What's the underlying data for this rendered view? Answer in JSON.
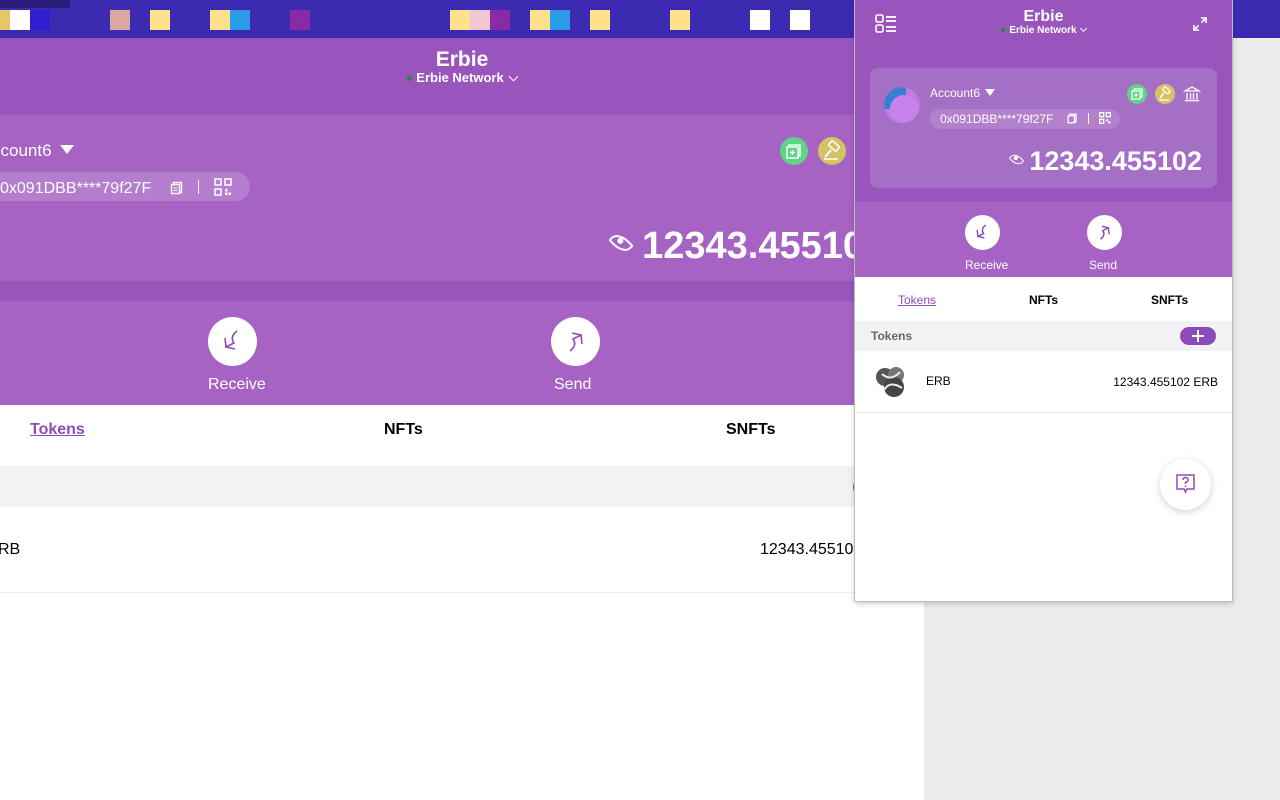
{
  "background": {
    "header": {
      "title": "Erbie",
      "network": "Erbie  Network"
    },
    "account": {
      "name": "ccount6",
      "address": "0x091DBB****79f27F",
      "balance": "12343.45510"
    },
    "actions": {
      "receive": "Receive",
      "send": "Send"
    },
    "tabs": [
      "Tokens",
      "NFTs",
      "SNFTs"
    ],
    "token_row": {
      "symbol": "RB",
      "amount": "12343.45510"
    }
  },
  "popup": {
    "header": {
      "title": "Erbie",
      "network": "Erbie  Network"
    },
    "account": {
      "name": "Account6",
      "address": "0x091DBB****79f27F",
      "balance": "12343.455102"
    },
    "actions": {
      "receive": "Receive",
      "send": "Send"
    },
    "tabs": {
      "tokens": "Tokens",
      "nfts": "NFTs",
      "snfts": "SNFTs"
    },
    "tokens_section": {
      "label": "Tokens"
    },
    "token_row": {
      "symbol": "ERB",
      "amount": "12343.455102 ERB"
    }
  },
  "colors": {
    "primary": "#9a55bd",
    "card": "#a763c4",
    "accent": "#8d4bb8"
  }
}
